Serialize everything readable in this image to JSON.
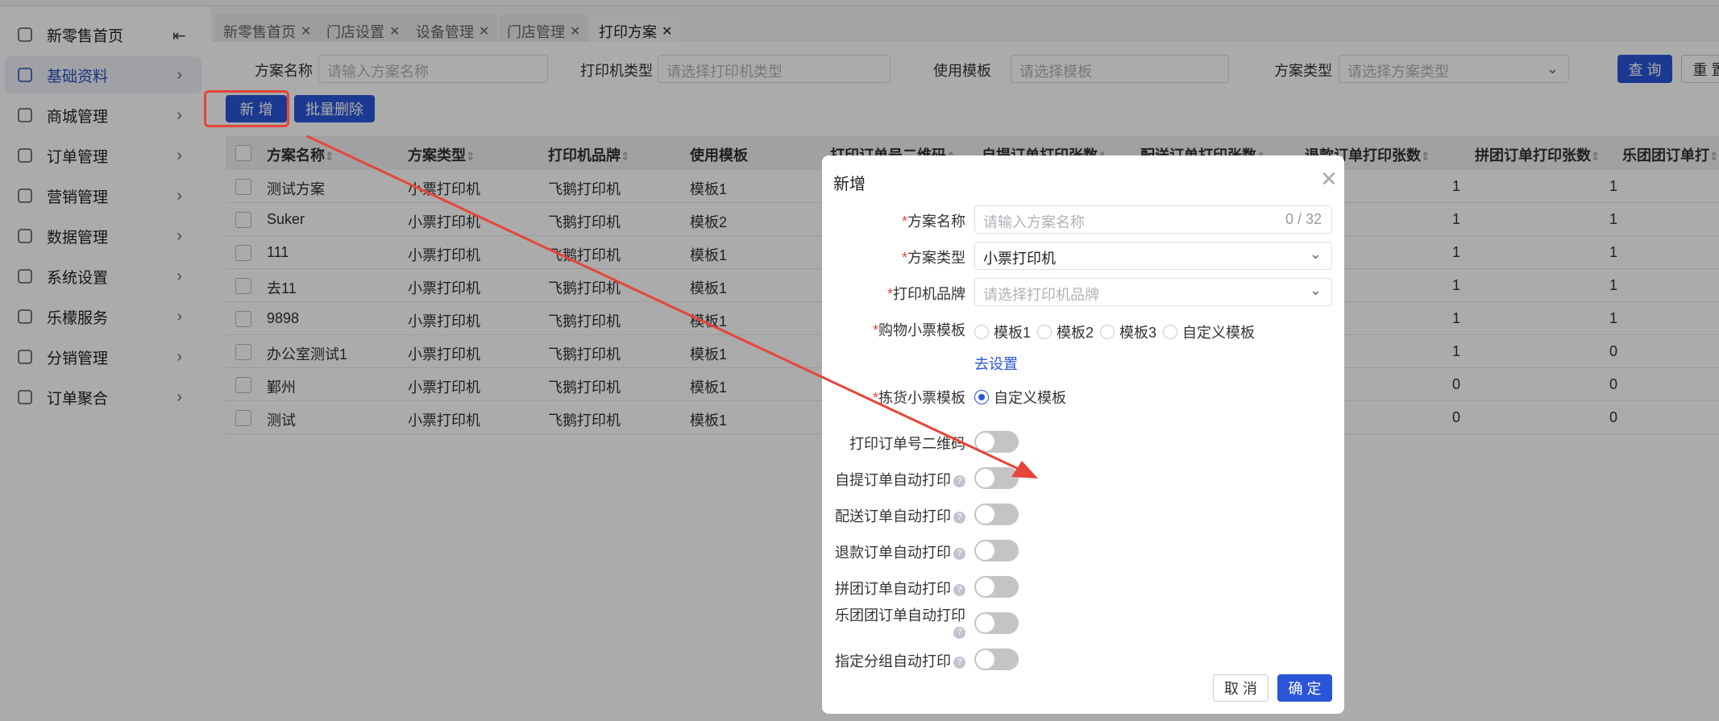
{
  "sidebar": {
    "items": [
      {
        "label": "新零售首页",
        "icon": "home-icon"
      },
      {
        "label": "基础资料",
        "icon": "grid-icon",
        "active": true
      },
      {
        "label": "商城管理",
        "icon": "store-icon"
      },
      {
        "label": "订单管理",
        "icon": "document-icon"
      },
      {
        "label": "营销管理",
        "icon": "monitor-icon"
      },
      {
        "label": "数据管理",
        "icon": "chart-icon"
      },
      {
        "label": "系统设置",
        "icon": "settings-icon"
      },
      {
        "label": "乐檬服务",
        "icon": "bag-icon"
      },
      {
        "label": "分销管理",
        "icon": "network-icon"
      },
      {
        "label": "订单聚合",
        "icon": "file-gear-icon"
      }
    ]
  },
  "tabs": [
    {
      "label": "新零售首页"
    },
    {
      "label": "门店设置"
    },
    {
      "label": "设备管理"
    },
    {
      "label": "门店管理"
    },
    {
      "label": "打印方案",
      "active": true
    }
  ],
  "filters": {
    "name_label": "方案名称",
    "name_placeholder": "请输入方案名称",
    "printer_type_label": "打印机类型",
    "printer_type_placeholder": "请选择打印机类型",
    "template_label": "使用模板",
    "template_placeholder": "请选择模板",
    "scheme_type_label": "方案类型",
    "scheme_type_placeholder": "请选择方案类型",
    "query": "查 询",
    "reset": "重 置"
  },
  "actions": {
    "add": "新 增",
    "batch_delete": "批量删除"
  },
  "table": {
    "columns": [
      "方案名称",
      "方案类型",
      "打印机品牌",
      "使用模板",
      "打印订单号二维码",
      "自提订单打印张数",
      "配送订单打印张数",
      "退款订单打印张数",
      "拼团订单打印张数",
      "乐团团订单打"
    ],
    "rows": [
      {
        "name": "测试方案",
        "type": "小票打印机",
        "brand": "飞鹅打印机",
        "template": "模板1",
        "refund": "1",
        "group": "1"
      },
      {
        "name": "Suker",
        "type": "小票打印机",
        "brand": "飞鹅打印机",
        "template": "模板2",
        "refund": "1",
        "group": "1"
      },
      {
        "name": "111",
        "type": "小票打印机",
        "brand": "飞鹅打印机",
        "template": "模板1",
        "refund": "1",
        "group": "1"
      },
      {
        "name": "去11",
        "type": "小票打印机",
        "brand": "飞鹅打印机",
        "template": "模板1",
        "refund": "1",
        "group": "1"
      },
      {
        "name": "9898",
        "type": "小票打印机",
        "brand": "飞鹅打印机",
        "template": "模板1",
        "refund": "1",
        "group": "1"
      },
      {
        "name": "办公室测试1",
        "type": "小票打印机",
        "brand": "飞鹅打印机",
        "template": "模板1",
        "refund": "1",
        "group": "0"
      },
      {
        "name": "鄞州",
        "type": "小票打印机",
        "brand": "飞鹅打印机",
        "template": "模板1",
        "refund": "0",
        "group": "0"
      },
      {
        "name": "测试",
        "type": "小票打印机",
        "brand": "飞鹅打印机",
        "template": "模板1",
        "refund": "0",
        "group": "0"
      }
    ]
  },
  "dialog": {
    "title": "新增",
    "name_label": "方案名称",
    "name_placeholder": "请输入方案名称",
    "name_count": "0 / 32",
    "type_label": "方案类型",
    "type_value": "小票打印机",
    "brand_label": "打印机品牌",
    "brand_placeholder": "请选择打印机品牌",
    "shop_ticket_label": "购物小票模板",
    "shop_ticket_options": [
      "模板1",
      "模板2",
      "模板3",
      "自定义模板"
    ],
    "goto_settings": "去设置",
    "pick_ticket_label": "拣货小票模板",
    "pick_ticket_option": "自定义模板",
    "toggles": [
      {
        "label": "打印订单号二维码",
        "help": false,
        "on": false
      },
      {
        "label": "自提订单自动打印",
        "help": true,
        "on": false
      },
      {
        "label": "配送订单自动打印",
        "help": true,
        "on": false
      },
      {
        "label": "退款订单自动打印",
        "help": true,
        "on": false
      },
      {
        "label": "拼团订单自动打印",
        "help": true,
        "on": false
      },
      {
        "label": "乐团团订单自动打印",
        "help": true,
        "on": false
      },
      {
        "label": "指定分组自动打印",
        "help": true,
        "on": false
      }
    ],
    "cancel": "取 消",
    "confirm": "确 定"
  },
  "colors": {
    "primary": "#2a55d9",
    "annotation": "#e6453a"
  }
}
